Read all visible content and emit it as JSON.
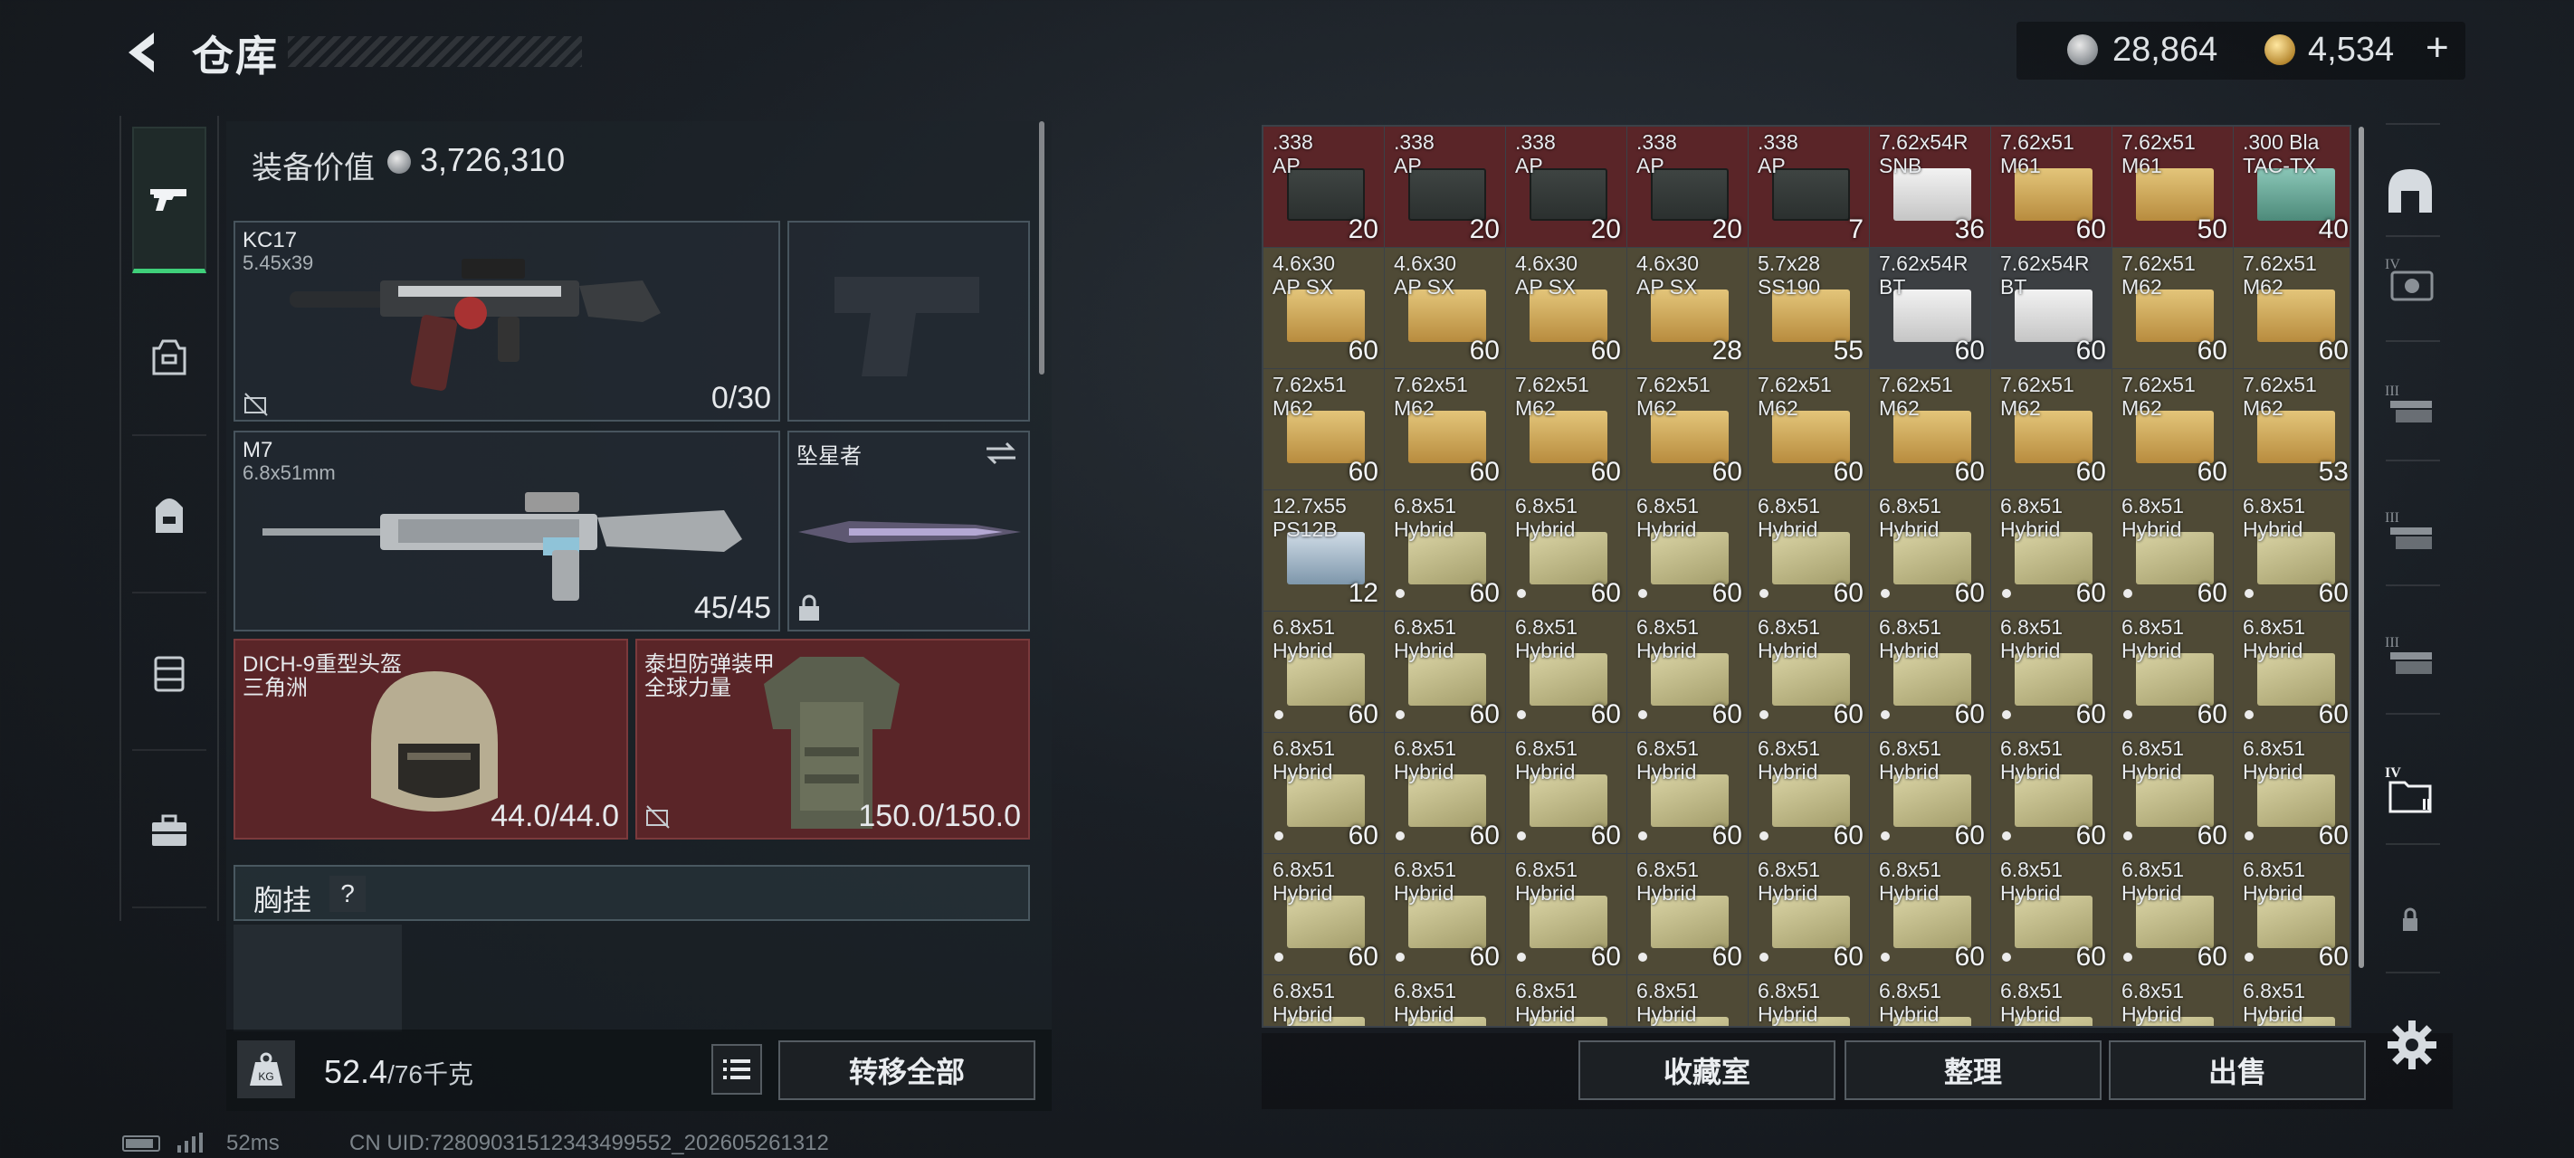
{
  "header": {
    "title": "仓库",
    "silver": "28,864",
    "gold": "4,534",
    "gold_plus": "+"
  },
  "equipment": {
    "value_label": "装备价值",
    "value": "3,726,310",
    "primary": {
      "name": "KC17",
      "caliber": "5.45x39",
      "ammo": "0/30"
    },
    "secondary": {
      "name": "M7",
      "caliber": "6.8x51mm",
      "ammo": "45/45"
    },
    "melee": {
      "name": "坠星者"
    },
    "helmet": {
      "name": "DICH-9重型头盔",
      "brand": "三角洲",
      "durability": "44.0/44.0"
    },
    "armor": {
      "name": "泰坦防弹装甲",
      "brand": "全球力量",
      "durability": "150.0/150.0"
    },
    "chest_rig": {
      "label": "胸挂",
      "help": "?"
    }
  },
  "footer": {
    "weight": "52.4",
    "weight_max": "/76千克",
    "kg_label": "KG",
    "transfer_all": "转移全部"
  },
  "storage": {
    "items": [
      {
        "name": ".338\nAP",
        "count": "20",
        "style": "red",
        "art": "crate"
      },
      {
        "name": ".338\nAP",
        "count": "20",
        "style": "red",
        "art": "crate"
      },
      {
        "name": ".338\nAP",
        "count": "20",
        "style": "red",
        "art": "crate"
      },
      {
        "name": ".338\nAP",
        "count": "20",
        "style": "red",
        "art": "crate"
      },
      {
        "name": ".338\nAP",
        "count": "7",
        "style": "red",
        "art": "crate"
      },
      {
        "name": "7.62x54R\nSNB",
        "count": "36",
        "style": "red",
        "art": "white"
      },
      {
        "name": "7.62x51\nM61",
        "count": "60",
        "style": "red",
        "art": "gold"
      },
      {
        "name": "7.62x51\nM61",
        "count": "50",
        "style": "red",
        "art": "gold"
      },
      {
        "name": ".300 Bla\nTAC-TX",
        "count": "40",
        "style": "red",
        "art": "tealbox"
      },
      {
        "name": "4.6x30\nAP SX",
        "count": "60",
        "style": "tan",
        "art": "gold"
      },
      {
        "name": "4.6x30\nAP SX",
        "count": "60",
        "style": "tan",
        "art": "gold"
      },
      {
        "name": "4.6x30\nAP SX",
        "count": "60",
        "style": "tan",
        "art": "gold"
      },
      {
        "name": "4.6x30\nAP SX",
        "count": "28",
        "style": "tan",
        "art": "gold"
      },
      {
        "name": "5.7x28\nSS190",
        "count": "55",
        "style": "tan",
        "art": "gold"
      },
      {
        "name": "7.62x54R\nBT",
        "count": "60",
        "style": "grey",
        "art": "white"
      },
      {
        "name": "7.62x54R\nBT",
        "count": "60",
        "style": "grey",
        "art": "white"
      },
      {
        "name": "7.62x51\nM62",
        "count": "60",
        "style": "tan",
        "art": "gold"
      },
      {
        "name": "7.62x51\nM62",
        "count": "60",
        "style": "tan",
        "art": "gold"
      },
      {
        "name": "7.62x51\nM62",
        "count": "60",
        "style": "tan",
        "art": "gold"
      },
      {
        "name": "7.62x51\nM62",
        "count": "60",
        "style": "tan",
        "art": "gold"
      },
      {
        "name": "7.62x51\nM62",
        "count": "60",
        "style": "tan",
        "art": "gold"
      },
      {
        "name": "7.62x51\nM62",
        "count": "60",
        "style": "tan",
        "art": "gold"
      },
      {
        "name": "7.62x51\nM62",
        "count": "60",
        "style": "tan",
        "art": "gold"
      },
      {
        "name": "7.62x51\nM62",
        "count": "60",
        "style": "tan",
        "art": "gold"
      },
      {
        "name": "7.62x51\nM62",
        "count": "60",
        "style": "tan",
        "art": "gold"
      },
      {
        "name": "7.62x51\nM62",
        "count": "60",
        "style": "tan",
        "art": "gold"
      },
      {
        "name": "7.62x51\nM62",
        "count": "53",
        "style": "tan",
        "art": "gold"
      },
      {
        "name": "12.7x55\nPS12B",
        "count": "12",
        "style": "tan",
        "art": "bluebox"
      },
      {
        "name": "6.8x51\nHybrid",
        "count": "60",
        "style": "tan",
        "art": "hybrid",
        "dot": true
      },
      {
        "name": "6.8x51\nHybrid",
        "count": "60",
        "style": "tan",
        "art": "hybrid",
        "dot": true
      },
      {
        "name": "6.8x51\nHybrid",
        "count": "60",
        "style": "tan",
        "art": "hybrid",
        "dot": true
      },
      {
        "name": "6.8x51\nHybrid",
        "count": "60",
        "style": "tan",
        "art": "hybrid",
        "dot": true
      },
      {
        "name": "6.8x51\nHybrid",
        "count": "60",
        "style": "tan",
        "art": "hybrid",
        "dot": true
      },
      {
        "name": "6.8x51\nHybrid",
        "count": "60",
        "style": "tan",
        "art": "hybrid",
        "dot": true
      },
      {
        "name": "6.8x51\nHybrid",
        "count": "60",
        "style": "tan",
        "art": "hybrid",
        "dot": true
      },
      {
        "name": "6.8x51\nHybrid",
        "count": "60",
        "style": "tan",
        "art": "hybrid",
        "dot": true
      },
      {
        "name": "6.8x51\nHybrid",
        "count": "60",
        "style": "tan",
        "art": "hybrid",
        "dot": true
      },
      {
        "name": "6.8x51\nHybrid",
        "count": "60",
        "style": "tan",
        "art": "hybrid",
        "dot": true
      },
      {
        "name": "6.8x51\nHybrid",
        "count": "60",
        "style": "tan",
        "art": "hybrid",
        "dot": true
      },
      {
        "name": "6.8x51\nHybrid",
        "count": "60",
        "style": "tan",
        "art": "hybrid",
        "dot": true
      },
      {
        "name": "6.8x51\nHybrid",
        "count": "60",
        "style": "tan",
        "art": "hybrid",
        "dot": true
      },
      {
        "name": "6.8x51\nHybrid",
        "count": "60",
        "style": "tan",
        "art": "hybrid",
        "dot": true
      },
      {
        "name": "6.8x51\nHybrid",
        "count": "60",
        "style": "tan",
        "art": "hybrid",
        "dot": true
      },
      {
        "name": "6.8x51\nHybrid",
        "count": "60",
        "style": "tan",
        "art": "hybrid",
        "dot": true
      },
      {
        "name": "6.8x51\nHybrid",
        "count": "60",
        "style": "tan",
        "art": "hybrid",
        "dot": true
      },
      {
        "name": "6.8x51\nHybrid",
        "count": "60",
        "style": "tan",
        "art": "hybrid",
        "dot": true
      },
      {
        "name": "6.8x51\nHybrid",
        "count": "60",
        "style": "tan",
        "art": "hybrid",
        "dot": true
      },
      {
        "name": "6.8x51\nHybrid",
        "count": "60",
        "style": "tan",
        "art": "hybrid",
        "dot": true
      },
      {
        "name": "6.8x51\nHybrid",
        "count": "60",
        "style": "tan",
        "art": "hybrid",
        "dot": true
      },
      {
        "name": "6.8x51\nHybrid",
        "count": "60",
        "style": "tan",
        "art": "hybrid",
        "dot": true
      },
      {
        "name": "6.8x51\nHybrid",
        "count": "60",
        "style": "tan",
        "art": "hybrid",
        "dot": true
      },
      {
        "name": "6.8x51\nHybrid",
        "count": "60",
        "style": "tan",
        "art": "hybrid",
        "dot": true
      },
      {
        "name": "6.8x51\nHybrid",
        "count": "60",
        "style": "tan",
        "art": "hybrid",
        "dot": true
      },
      {
        "name": "6.8x51\nHybrid",
        "count": "60",
        "style": "tan",
        "art": "hybrid",
        "dot": true
      },
      {
        "name": "6.8x51\nHybrid",
        "count": "60",
        "style": "tan",
        "art": "hybrid",
        "dot": true
      },
      {
        "name": "6.8x51\nHybrid",
        "count": "60",
        "style": "tan",
        "art": "hybrid",
        "dot": true
      },
      {
        "name": "6.8x51\nHybrid",
        "count": "60",
        "style": "tan",
        "art": "hybrid",
        "dot": true
      },
      {
        "name": "6.8x51\nHybrid",
        "count": "60",
        "style": "tan",
        "art": "hybrid",
        "dot": true
      },
      {
        "name": "6.8x51\nHybrid",
        "count": "60",
        "style": "tan",
        "art": "hybrid",
        "dot": true
      },
      {
        "name": "6.8x51\nHybrid",
        "count": "60",
        "style": "tan",
        "art": "hybrid",
        "dot": true
      },
      {
        "name": "6.8x51\nHybrid",
        "count": "60",
        "style": "tan",
        "art": "hybrid",
        "dot": true
      },
      {
        "name": "6.8x51\nHybrid",
        "count": "60",
        "style": "tan",
        "art": "hybrid",
        "dot": true
      },
      {
        "name": "6.8x51\nHybrid",
        "count": "60",
        "style": "tan",
        "art": "hybrid",
        "dot": true
      },
      {
        "name": "6.8x51\nHybrid",
        "count": "",
        "style": "tan",
        "art": "hybrid"
      },
      {
        "name": "6.8x51\nHybrid",
        "count": "",
        "style": "tan",
        "art": "hybrid"
      },
      {
        "name": "6.8x51\nHybrid",
        "count": "",
        "style": "tan",
        "art": "hybrid"
      },
      {
        "name": "6.8x51\nHybrid",
        "count": "",
        "style": "tan",
        "art": "hybrid"
      },
      {
        "name": "6.8x51\nHybrid",
        "count": "",
        "style": "tan",
        "art": "hybrid"
      },
      {
        "name": "6.8x51\nHybrid",
        "count": "",
        "style": "tan",
        "art": "hybrid"
      },
      {
        "name": "6.8x51\nHybrid",
        "count": "",
        "style": "tan",
        "art": "hybrid"
      },
      {
        "name": "6.8x51\nHybrid",
        "count": "",
        "style": "tan",
        "art": "hybrid"
      },
      {
        "name": "6.8x51\nHybrid",
        "count": "",
        "style": "tan",
        "art": "hybrid"
      }
    ]
  },
  "actions": {
    "collection": "收藏室",
    "sort": "整理",
    "sell": "出售"
  },
  "left_tabs": [
    "gun-icon",
    "backpack-rig-icon",
    "backpack-icon",
    "locker-icon",
    "briefcase-icon"
  ],
  "right_tabs": {
    "labels": [
      "IV",
      "III",
      "III",
      "III",
      "IV"
    ]
  },
  "status": {
    "ping": "52ms",
    "uid": "CN UID:7280903151234349​9552_202605261312"
  },
  "colors": {
    "accent_green": "#3fd07a",
    "red_item": "#5a2528",
    "tan_item": "#4f4a36"
  }
}
